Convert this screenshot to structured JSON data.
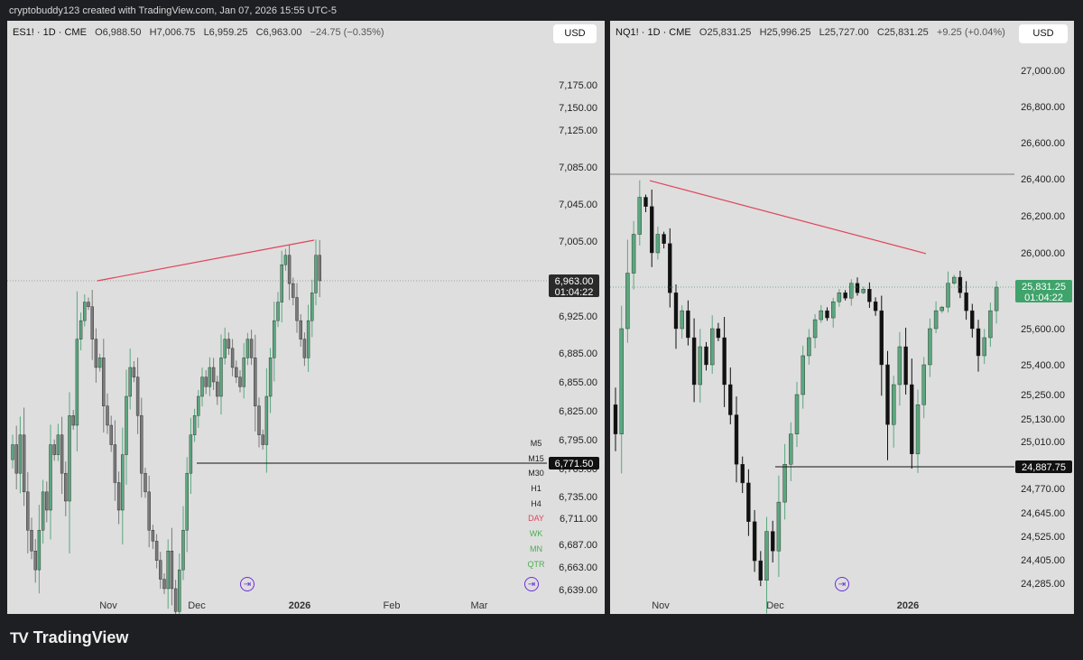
{
  "attribution": "cryptobuddy123 created with TradingView.com, Jan 07, 2026 15:55 UTC-5",
  "footer": {
    "brand": "TradingView",
    "logo_mark": "TV"
  },
  "colors": {
    "bull": "#5aa77e",
    "bear_left": "#7a7a7a",
    "bear_right": "#111111",
    "trendline": "#e0445a",
    "price_tag_bg": "#2a2a2a",
    "price_tag_green": "#3fa36b",
    "panel_bg": "#dedede"
  },
  "left_chart": {
    "header": {
      "symbol": "ES1! · 1D · CME",
      "open": "O6,988.50",
      "high": "H7,006.75",
      "low": "L6,959.25",
      "close": "C6,963.00",
      "change": "−24.75 (−0.35%)"
    },
    "currency": "USD",
    "y_labels": [
      "7,175.00",
      "7,150.00",
      "7,125.00",
      "7,085.00",
      "7,045.00",
      "7,005.00",
      "6,925.00",
      "6,885.00",
      "6,855.00",
      "6,825.00",
      "6,795.00",
      "6,765.00",
      "6,735.00",
      "6,711.00",
      "6,687.00",
      "6,663.00",
      "6,639.00"
    ],
    "y_values": [
      7175,
      7150,
      7125,
      7085,
      7045,
      7005,
      6925,
      6885,
      6855,
      6825,
      6795,
      6765,
      6735,
      6711,
      6687,
      6663,
      6639
    ],
    "x_labels": [
      {
        "text": "Nov",
        "bold": false
      },
      {
        "text": "Dec",
        "bold": false
      },
      {
        "text": "2026",
        "bold": true
      },
      {
        "text": "Feb",
        "bold": false
      },
      {
        "text": "Mar",
        "bold": false
      }
    ],
    "last_price": "6,963.00",
    "countdown": "01:04:22",
    "level_price": "6,771.50",
    "timeframes": [
      {
        "label": "M5",
        "color": "#222222"
      },
      {
        "label": "M15",
        "color": "#222222"
      },
      {
        "label": "M30",
        "color": "#222222"
      },
      {
        "label": "H1",
        "color": "#222222"
      },
      {
        "label": "H4",
        "color": "#222222"
      },
      {
        "label": "DAY",
        "color": "#e0445a"
      },
      {
        "label": "WK",
        "color": "#4caf50"
      },
      {
        "label": "MN",
        "color": "#4caf50"
      },
      {
        "label": "QTR",
        "color": "#4caf50"
      }
    ],
    "goto_icon": "goto-realtime-icon"
  },
  "right_chart": {
    "header": {
      "symbol": "NQ1! · 1D · CME",
      "open": "O25,831.25",
      "high": "H25,996.25",
      "low": "L25,727.00",
      "close": "C25,831.25",
      "change": "+9.25 (+0.04%)"
    },
    "currency": "USD",
    "y_labels": [
      "27,000.00",
      "26,800.00",
      "26,600.00",
      "26,400.00",
      "26,200.00",
      "26,000.00",
      "25,600.00",
      "25,400.00",
      "25,250.00",
      "25,130.00",
      "25,010.00",
      "24,770.00",
      "24,645.00",
      "24,525.00",
      "24,405.00",
      "24,285.00"
    ],
    "y_values": [
      27000,
      26800,
      26600,
      26400,
      26200,
      26000,
      25600,
      25400,
      25250,
      25130,
      25010,
      24770,
      24645,
      24525,
      24405,
      24285
    ],
    "x_labels": [
      {
        "text": "Nov",
        "bold": false
      },
      {
        "text": "Dec",
        "bold": false
      },
      {
        "text": "2026",
        "bold": true
      }
    ],
    "last_price": "25,831.25",
    "countdown": "01:04:22",
    "level_price": "24,887.75",
    "goto_icon": "goto-realtime-icon"
  }
}
